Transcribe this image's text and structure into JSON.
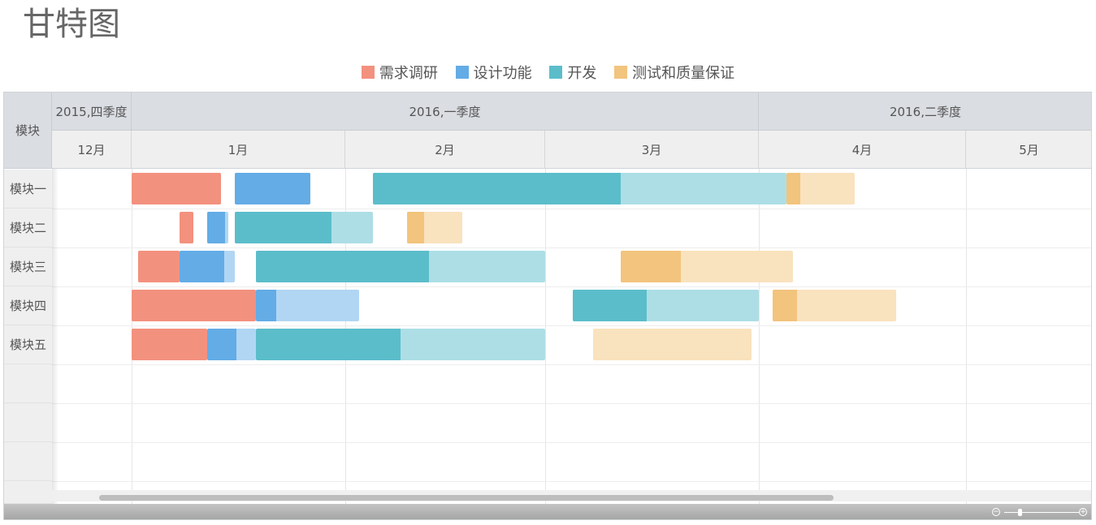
{
  "title": "甘特图",
  "legend": [
    {
      "label": "需求调研",
      "color": "#f3917f"
    },
    {
      "label": "设计功能",
      "color": "#63ace6"
    },
    {
      "label": "开发",
      "color": "#5bbdca"
    },
    {
      "label": "测试和质量保证",
      "color": "#f2c47d"
    }
  ],
  "header": {
    "corner_label": "模块",
    "quarters": [
      "2015,四季度",
      "2016,一季度",
      "2016,二季度"
    ],
    "months": [
      "12月",
      "1月",
      "2月",
      "3月",
      "4月",
      "5月"
    ]
  },
  "icons": {
    "zoom_out": "zoom-out-icon",
    "zoom_in": "zoom-in-icon"
  },
  "chart_data": {
    "type": "gantt",
    "title": "甘特图",
    "x_unit": "date",
    "x_range": [
      "2015-12-01",
      "2016-05-31"
    ],
    "categories": [
      "模块一",
      "模块二",
      "模块三",
      "模块四",
      "模块五"
    ],
    "tasks": [
      {
        "module": "模块一",
        "phase": "需求调研",
        "start": "2016-01-01",
        "end": "2016-01-14",
        "progress": 1.0
      },
      {
        "module": "模块一",
        "phase": "设计功能",
        "start": "2016-01-16",
        "end": "2016-01-27",
        "progress": 1.0
      },
      {
        "module": "模块一",
        "phase": "开发",
        "start": "2016-02-05",
        "end": "2016-04-05",
        "progress": 0.6
      },
      {
        "module": "模块一",
        "phase": "测试和质量保证",
        "start": "2016-04-05",
        "end": "2016-04-15",
        "progress": 0.2
      },
      {
        "module": "模块二",
        "phase": "需求调研",
        "start": "2016-01-08",
        "end": "2016-01-10",
        "progress": 1.0
      },
      {
        "module": "模块二",
        "phase": "设计功能",
        "start": "2016-01-12",
        "end": "2016-01-15",
        "progress": 0.85
      },
      {
        "module": "模块二",
        "phase": "开发",
        "start": "2016-01-16",
        "end": "2016-02-05",
        "progress": 0.7
      },
      {
        "module": "模块二",
        "phase": "测试和质量保证",
        "start": "2016-02-10",
        "end": "2016-02-18",
        "progress": 0.3
      },
      {
        "module": "模块三",
        "phase": "需求调研",
        "start": "2016-01-02",
        "end": "2016-01-08",
        "progress": 1.0
      },
      {
        "module": "模块三",
        "phase": "设计功能",
        "start": "2016-01-08",
        "end": "2016-01-16",
        "progress": 0.8
      },
      {
        "module": "模块三",
        "phase": "开发",
        "start": "2016-01-19",
        "end": "2016-03-01",
        "progress": 0.6
      },
      {
        "module": "模块三",
        "phase": "测试和质量保证",
        "start": "2016-03-12",
        "end": "2016-04-06",
        "progress": 0.35
      },
      {
        "module": "模块四",
        "phase": "需求调研",
        "start": "2016-01-01",
        "end": "2016-01-19",
        "progress": 1.0
      },
      {
        "module": "模块四",
        "phase": "设计功能",
        "start": "2016-01-19",
        "end": "2016-02-03",
        "progress": 0.2
      },
      {
        "module": "模块四",
        "phase": "开发",
        "start": "2016-03-05",
        "end": "2016-04-01",
        "progress": 0.4
      },
      {
        "module": "模块四",
        "phase": "测试和质量保证",
        "start": "2016-04-03",
        "end": "2016-04-21",
        "progress": 0.2
      },
      {
        "module": "模块五",
        "phase": "需求调研",
        "start": "2016-01-01",
        "end": "2016-01-12",
        "progress": 1.0
      },
      {
        "module": "模块五",
        "phase": "设计功能",
        "start": "2016-01-12",
        "end": "2016-01-19",
        "progress": 0.6
      },
      {
        "module": "模块五",
        "phase": "开发",
        "start": "2016-01-19",
        "end": "2016-03-01",
        "progress": 0.5
      },
      {
        "module": "模块五",
        "phase": "测试和质量保证",
        "start": "2016-03-08",
        "end": "2016-03-31",
        "progress": 0.0
      }
    ]
  }
}
